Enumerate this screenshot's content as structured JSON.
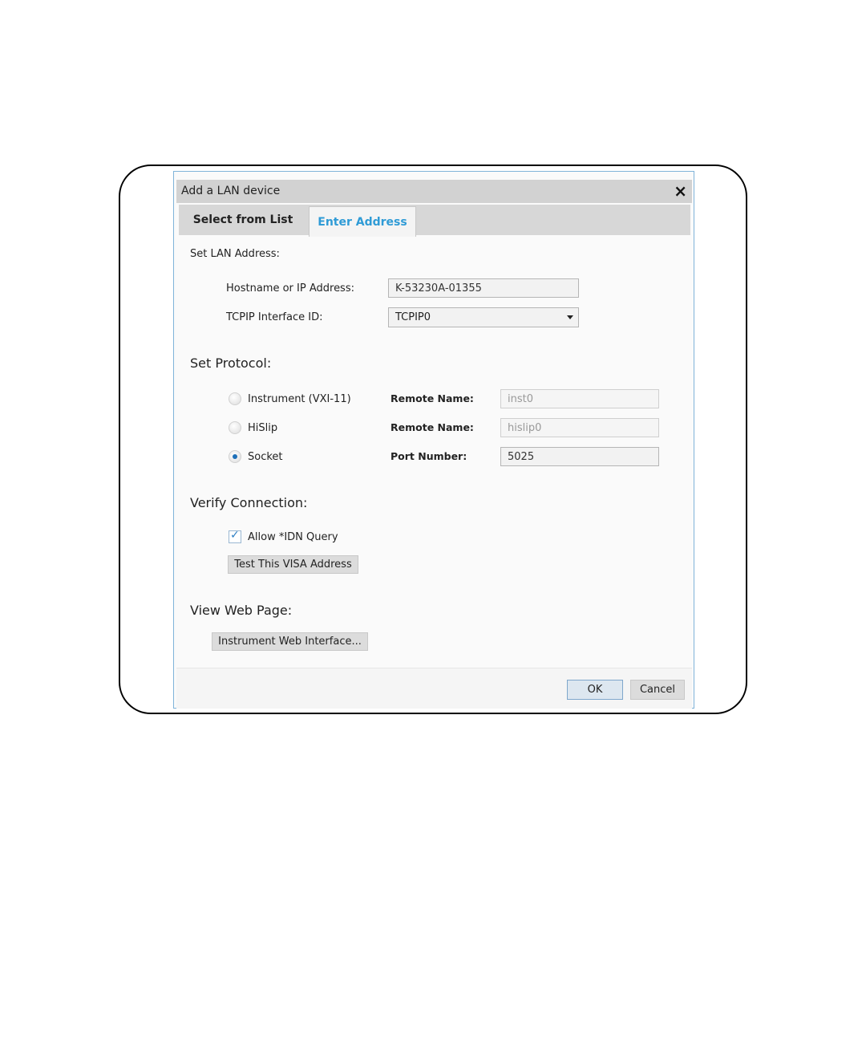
{
  "dialog": {
    "title": "Add a LAN device",
    "close_symbol": "×",
    "tabs": [
      {
        "label": "Select from List",
        "active": false
      },
      {
        "label": "Enter Address",
        "active": true
      }
    ]
  },
  "lan": {
    "heading": "Set LAN Address:",
    "hostname_label": "Hostname or IP Address:",
    "hostname_value": "K-53230A-01355",
    "interface_label": "TCPIP Interface ID:",
    "interface_value": "TCPIP0"
  },
  "protocol": {
    "heading": "Set Protocol:",
    "options": [
      {
        "label": "Instrument (VXI-11)",
        "field_label": "Remote Name:",
        "field_value": "inst0",
        "selected": false
      },
      {
        "label": "HiSlip",
        "field_label": "Remote Name:",
        "field_value": "hislip0",
        "selected": false
      },
      {
        "label": "Socket",
        "field_label": "Port Number:",
        "field_value": "5025",
        "selected": true
      }
    ]
  },
  "verify": {
    "heading": "Verify Connection:",
    "checkbox_label": "Allow *IDN Query",
    "checkbox_symbol": "✓",
    "checked": true,
    "test_button": "Test This VISA Address"
  },
  "web": {
    "heading": "View Web Page:",
    "button": "Instrument Web Interface..."
  },
  "footer": {
    "ok": "OK",
    "cancel": "Cancel"
  },
  "colors": {
    "accent": "#2f9bd6",
    "border": "#7fb3d9"
  }
}
